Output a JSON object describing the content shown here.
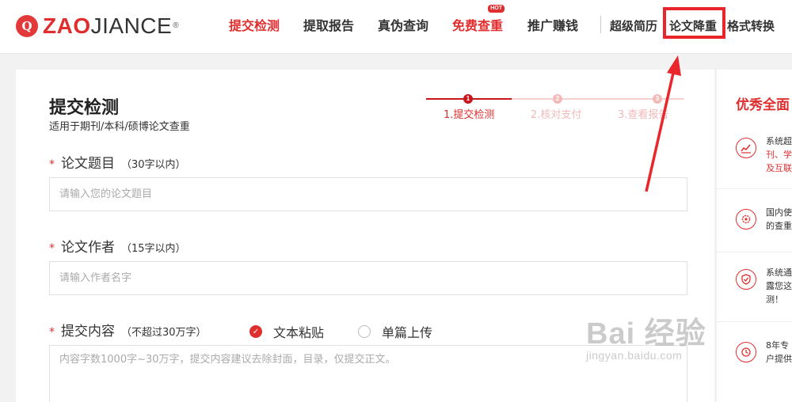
{
  "header": {
    "logo": {
      "mark": "Q",
      "brand_a": "ZAO",
      "brand_b": "JIANCE",
      "reg": "®"
    },
    "nav": [
      {
        "label": "提交检测",
        "state": "active"
      },
      {
        "label": "提取报告",
        "state": "normal"
      },
      {
        "label": "真伪查询",
        "state": "normal"
      },
      {
        "label": "免费查重",
        "state": "hot",
        "badge": "HOT"
      },
      {
        "label": "推广赚钱",
        "state": "normal"
      }
    ],
    "nav_right": [
      {
        "label": "超级简历"
      },
      {
        "label": "论文降重",
        "highlighted": true
      },
      {
        "label": "格式转换"
      }
    ]
  },
  "form": {
    "title": "提交检测",
    "subtitle": "适用于期刊/本科/硕博论文查重",
    "steps": [
      {
        "number": "1",
        "label": "1.提交检测",
        "state": "current"
      },
      {
        "number": "2",
        "label": "2.核对支付",
        "state": "pending"
      },
      {
        "number": "3",
        "label": "3.查看报告",
        "state": "pending"
      }
    ],
    "fields": {
      "title": {
        "required_mark": "*",
        "label": "论文题目",
        "hint": "（30字以内）",
        "placeholder": "请输入您的论文题目"
      },
      "author": {
        "required_mark": "*",
        "label": "论文作者",
        "hint": "（15字以内）",
        "placeholder": "请输入作者名字"
      },
      "content": {
        "required_mark": "*",
        "label": "提交内容",
        "hint": "（不超过30万字）",
        "placeholder": "内容字数1000字~30万字，提交内容建议去除封面，目录，仅提交正文。",
        "options": [
          {
            "label": "文本粘贴",
            "checked": true
          },
          {
            "label": "单篇上传",
            "checked": false
          }
        ]
      }
    }
  },
  "side_panel": {
    "title": "优秀全面",
    "items": [
      {
        "icon": "chart-icon",
        "text_a": "系统超",
        "text_b": "刊、学",
        "text_c": "及互联"
      },
      {
        "icon": "gear-icon",
        "text_a": "国内使",
        "text_b": "的查重"
      },
      {
        "icon": "shield-icon",
        "text_a": "系统通",
        "text_b": "露您这",
        "text_c": "测！"
      },
      {
        "icon": "clock-icon",
        "text_a": "8年专",
        "text_b": "户提供"
      }
    ]
  },
  "watermark": {
    "top": "Bai 经验",
    "bottom": "jingyan.baidu.com"
  },
  "colors": {
    "brand_red": "#e02e2e",
    "annotation_red": "#e8262b",
    "background": "#f2f2f2"
  }
}
